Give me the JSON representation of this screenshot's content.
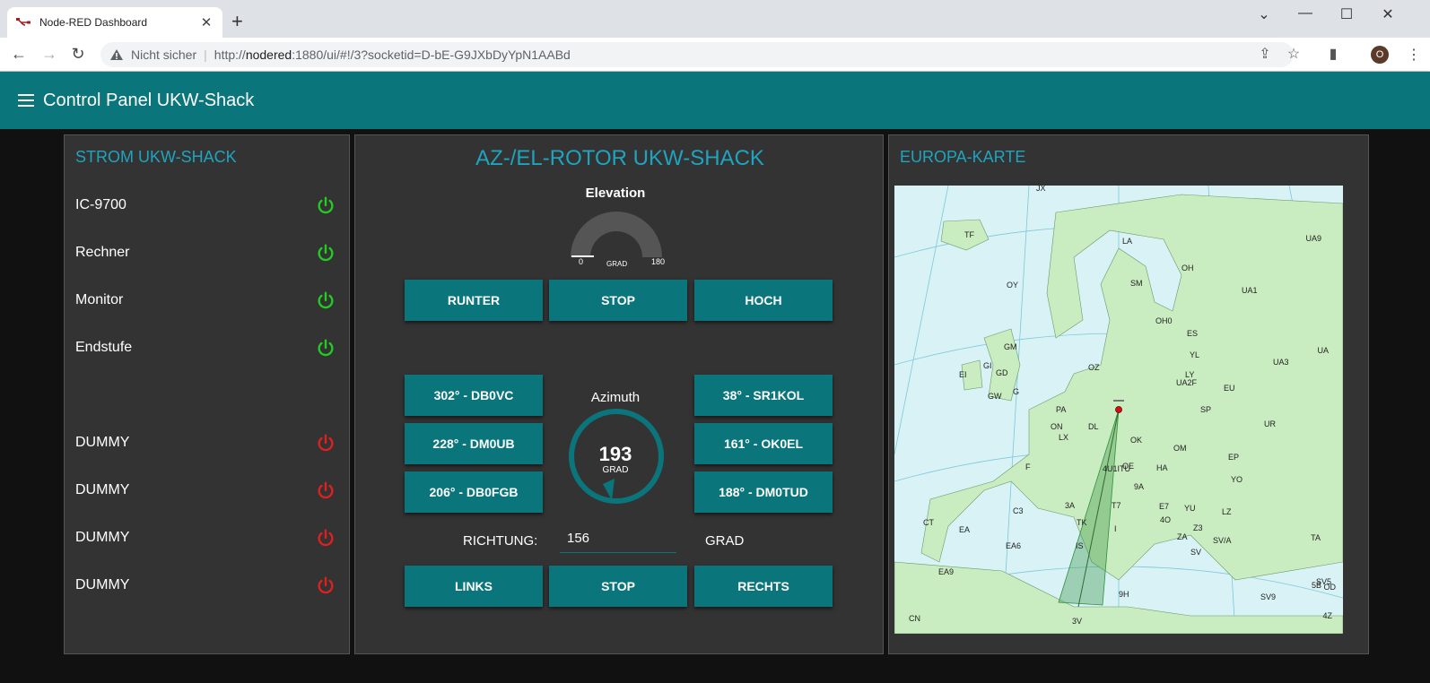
{
  "browser": {
    "tab_title": "Node-RED Dashboard",
    "new_tab_symbol": "+",
    "security_text": "Nicht sicher",
    "url_prefix": "http://",
    "url_host": "nodered",
    "url_rest": ":1880/ui/#!/3?socketid=D-bE-G9JXbDyYpN1AABd",
    "profile_initial": "O"
  },
  "header": {
    "title": "Control Panel UKW-Shack"
  },
  "power": {
    "title": "STROM UKW-SHACK",
    "on_color": "#22cc22",
    "off_color": "#e02020",
    "items": [
      {
        "label": "IC-9700",
        "state": "on"
      },
      {
        "label": "Rechner",
        "state": "on"
      },
      {
        "label": "Monitor",
        "state": "on"
      },
      {
        "label": "Endstufe",
        "state": "on"
      },
      {
        "label": "DUMMY",
        "state": "off"
      },
      {
        "label": "DUMMY",
        "state": "off"
      },
      {
        "label": "DUMMY",
        "state": "off"
      },
      {
        "label": "DUMMY",
        "state": "off"
      }
    ]
  },
  "rotor": {
    "title": "AZ-/EL-ROTOR UKW-SHACK",
    "elevation": {
      "label": "Elevation",
      "min": "0",
      "max": "180",
      "unit": "GRAD",
      "value": 0
    },
    "elevation_buttons": [
      "RUNTER",
      "STOP",
      "HOCH"
    ],
    "azimuth": {
      "label": "Azimuth",
      "value": "193",
      "unit": "GRAD"
    },
    "preset_left": [
      "302° - DB0VC",
      "228° - DM0UB",
      "206° - DB0FGB"
    ],
    "preset_right": [
      "38° - SR1KOL",
      "161° - OK0EL",
      "188° - DM0TUD"
    ],
    "direction": {
      "label": "RICHTUNG:",
      "value": "156",
      "unit": "GRAD"
    },
    "azimuth_buttons": [
      "LINKS",
      "STOP",
      "RECHTS"
    ]
  },
  "map": {
    "title": "EUROPA-KARTE",
    "labels": [
      "JX",
      "TF",
      "LA",
      "UA9",
      "OH",
      "SM",
      "UA1",
      "OY",
      "OH0",
      "ES",
      "GM",
      "YL",
      "UA3",
      "UA",
      "EI",
      "GI",
      "GD",
      "OZ",
      "LY",
      "UA2F",
      "GW",
      "G",
      "SP",
      "EU",
      "UR",
      "PA",
      "ON",
      "DL",
      "OK",
      "OM",
      "LX",
      "F",
      "4U1ITU",
      "OE",
      "HA",
      "EP",
      "YO",
      "9A",
      "E7",
      "YU",
      "4O",
      "Z3",
      "LZ",
      "C3",
      "3A",
      "T7",
      "CT",
      "EA",
      "TK",
      "I",
      "ZA",
      "SV/A",
      "TA",
      "EA6",
      "IS",
      "SV",
      "EA9",
      "SV5",
      "5B",
      "OD",
      "SV9",
      "9H",
      "CN",
      "3V",
      "4Z"
    ]
  }
}
